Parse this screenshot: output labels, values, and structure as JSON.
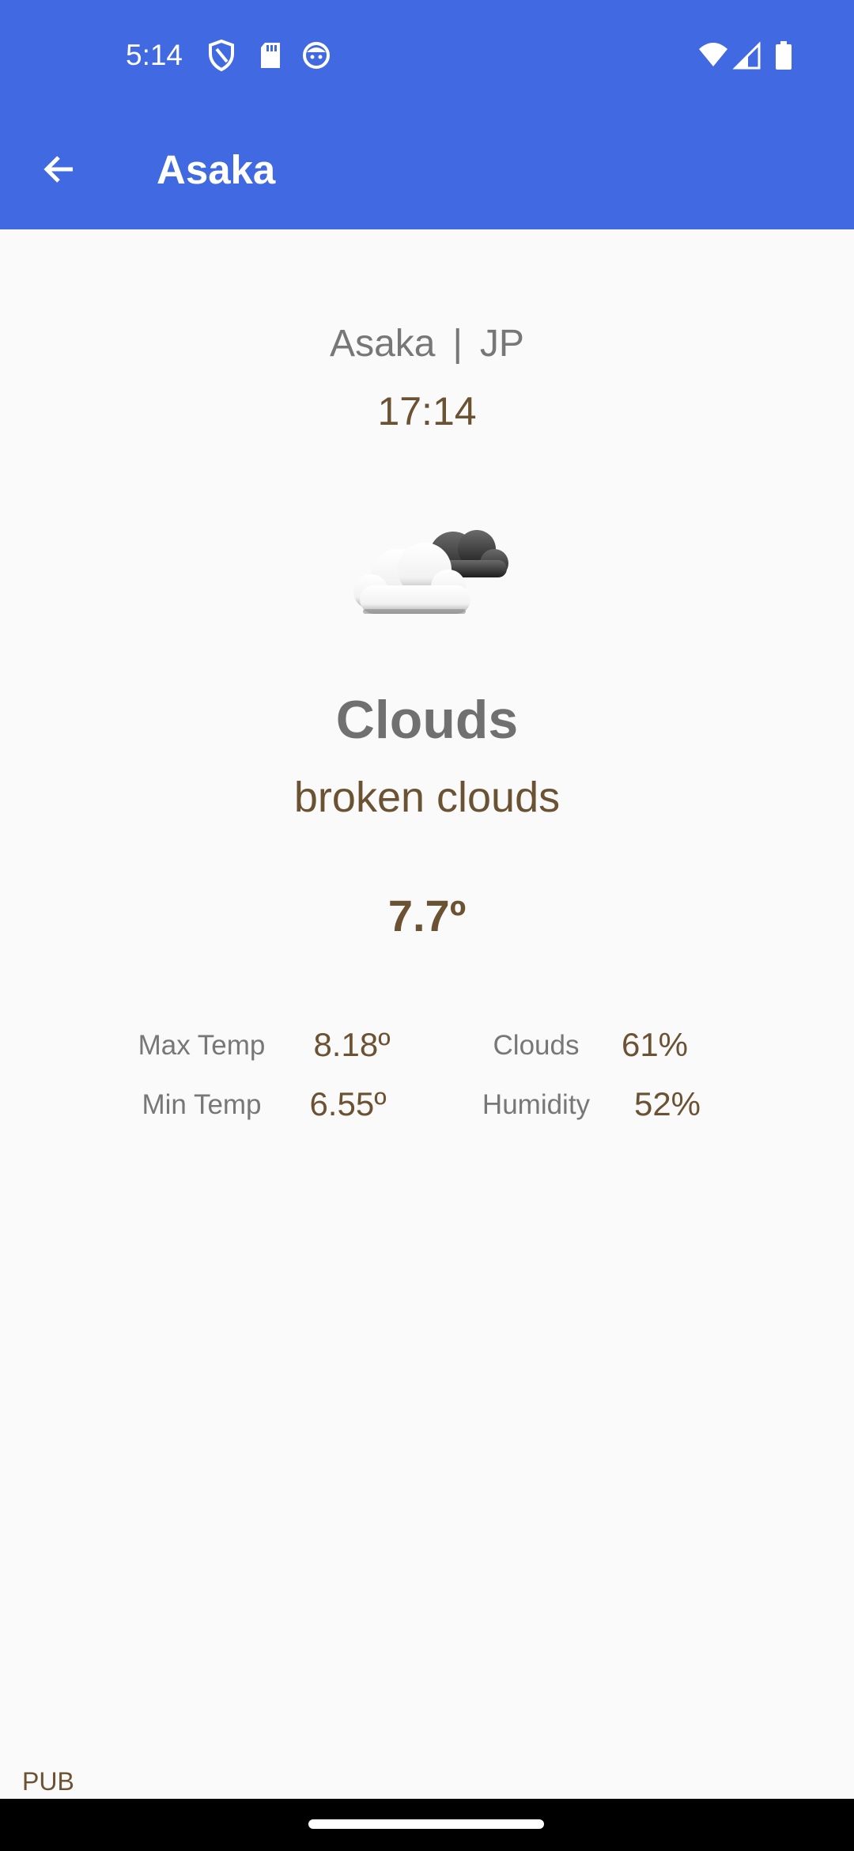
{
  "status_bar": {
    "time": "5:14",
    "left_icons": [
      "shield-icon",
      "sd-card-icon",
      "face-icon"
    ],
    "right_icons": [
      "wifi-icon",
      "cell-signal-icon",
      "battery-icon"
    ]
  },
  "app_bar": {
    "title": "Asaka",
    "back_icon": "arrow-back-icon",
    "color": "#4169e1"
  },
  "weather": {
    "city": "Asaka",
    "separator": "|",
    "country": "JP",
    "local_time": "17:14",
    "icon": "broken-clouds-icon",
    "main": "Clouds",
    "description": "broken clouds",
    "temperature": "7.7º"
  },
  "stats": {
    "max_temp_label": "Max Temp",
    "max_temp_value": "8.18º",
    "min_temp_label": "Min Temp",
    "min_temp_value": "6.55º",
    "clouds_label": "Clouds",
    "clouds_value": "61%",
    "humidity_label": "Humidity",
    "humidity_value": "52%"
  },
  "footer": {
    "pub_label": "PUB"
  },
  "colors": {
    "accent": "#4169e1",
    "value_brown": "#6b5232",
    "label_gray": "#777777",
    "background": "#fafafa"
  }
}
